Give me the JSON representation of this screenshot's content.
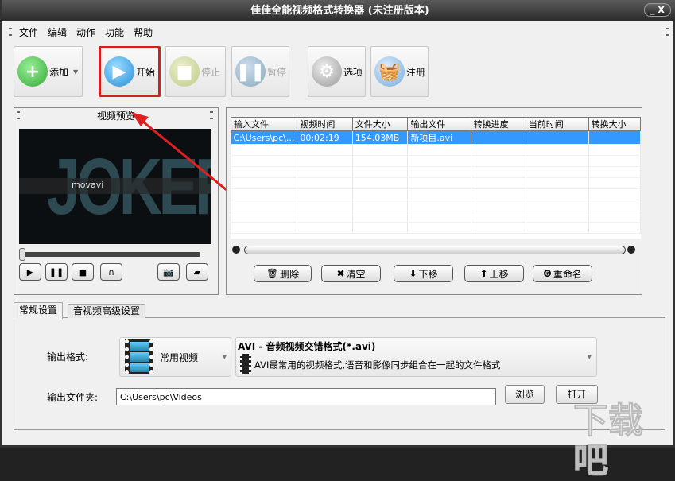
{
  "window": {
    "title": "佳佳全能视频格式转换器  (未注册版本)",
    "controls": "_ X"
  },
  "menu": [
    "文件",
    "编辑",
    "动作",
    "功能",
    "帮助"
  ],
  "toolbar": {
    "add": "添加",
    "start": "开始",
    "stop": "停止",
    "pause": "暂停",
    "options": "选项",
    "register": "注册"
  },
  "preview": {
    "title": "视频预览",
    "frame_text": "JOKER",
    "watermark": "movavi"
  },
  "table": {
    "columns": [
      "输入文件",
      "视频时间",
      "文件大小",
      "输出文件",
      "转换进度",
      "当前时间",
      "转换大小"
    ],
    "rows": [
      [
        "C:\\Users\\pc\\...",
        "00:02:19",
        "154.03MB",
        "新项目.avi",
        "",
        "",
        ""
      ]
    ]
  },
  "list_buttons": {
    "delete": "删除",
    "clear": "清空",
    "down": "下移",
    "up": "上移",
    "rename": "重命名"
  },
  "tabs": [
    "常规设置",
    "音视频高级设置"
  ],
  "settings": {
    "format_label": "输出格式:",
    "category": "常用视频",
    "format_title": "AVI - 音频视频交错格式(*.avi)",
    "format_desc": "AVI最常用的视频格式,语音和影像同步组合在一起的文件格式",
    "folder_label": "输出文件夹:",
    "folder_value": "C:\\Users\\pc\\Videos",
    "browse": "浏览",
    "open": "打开"
  },
  "watermark": "下载吧",
  "colors": {
    "selection": "#3399ff",
    "highlight": "#e02020"
  }
}
